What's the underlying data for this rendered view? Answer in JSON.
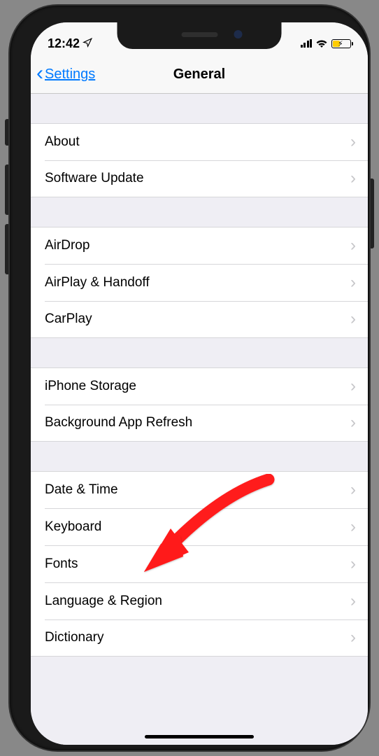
{
  "status_bar": {
    "time": "12:42"
  },
  "nav": {
    "back_label": "Settings",
    "title": "General"
  },
  "groups": [
    {
      "items": [
        {
          "key": "about",
          "label": "About"
        },
        {
          "key": "software-update",
          "label": "Software Update"
        }
      ]
    },
    {
      "items": [
        {
          "key": "airdrop",
          "label": "AirDrop"
        },
        {
          "key": "airplay-handoff",
          "label": "AirPlay & Handoff"
        },
        {
          "key": "carplay",
          "label": "CarPlay"
        }
      ]
    },
    {
      "items": [
        {
          "key": "iphone-storage",
          "label": "iPhone Storage"
        },
        {
          "key": "background-app-refresh",
          "label": "Background App Refresh"
        }
      ]
    },
    {
      "items": [
        {
          "key": "date-time",
          "label": "Date & Time"
        },
        {
          "key": "keyboard",
          "label": "Keyboard"
        },
        {
          "key": "fonts",
          "label": "Fonts"
        },
        {
          "key": "language-region",
          "label": "Language & Region"
        },
        {
          "key": "dictionary",
          "label": "Dictionary"
        }
      ]
    }
  ],
  "annotation": {
    "target": "keyboard"
  }
}
